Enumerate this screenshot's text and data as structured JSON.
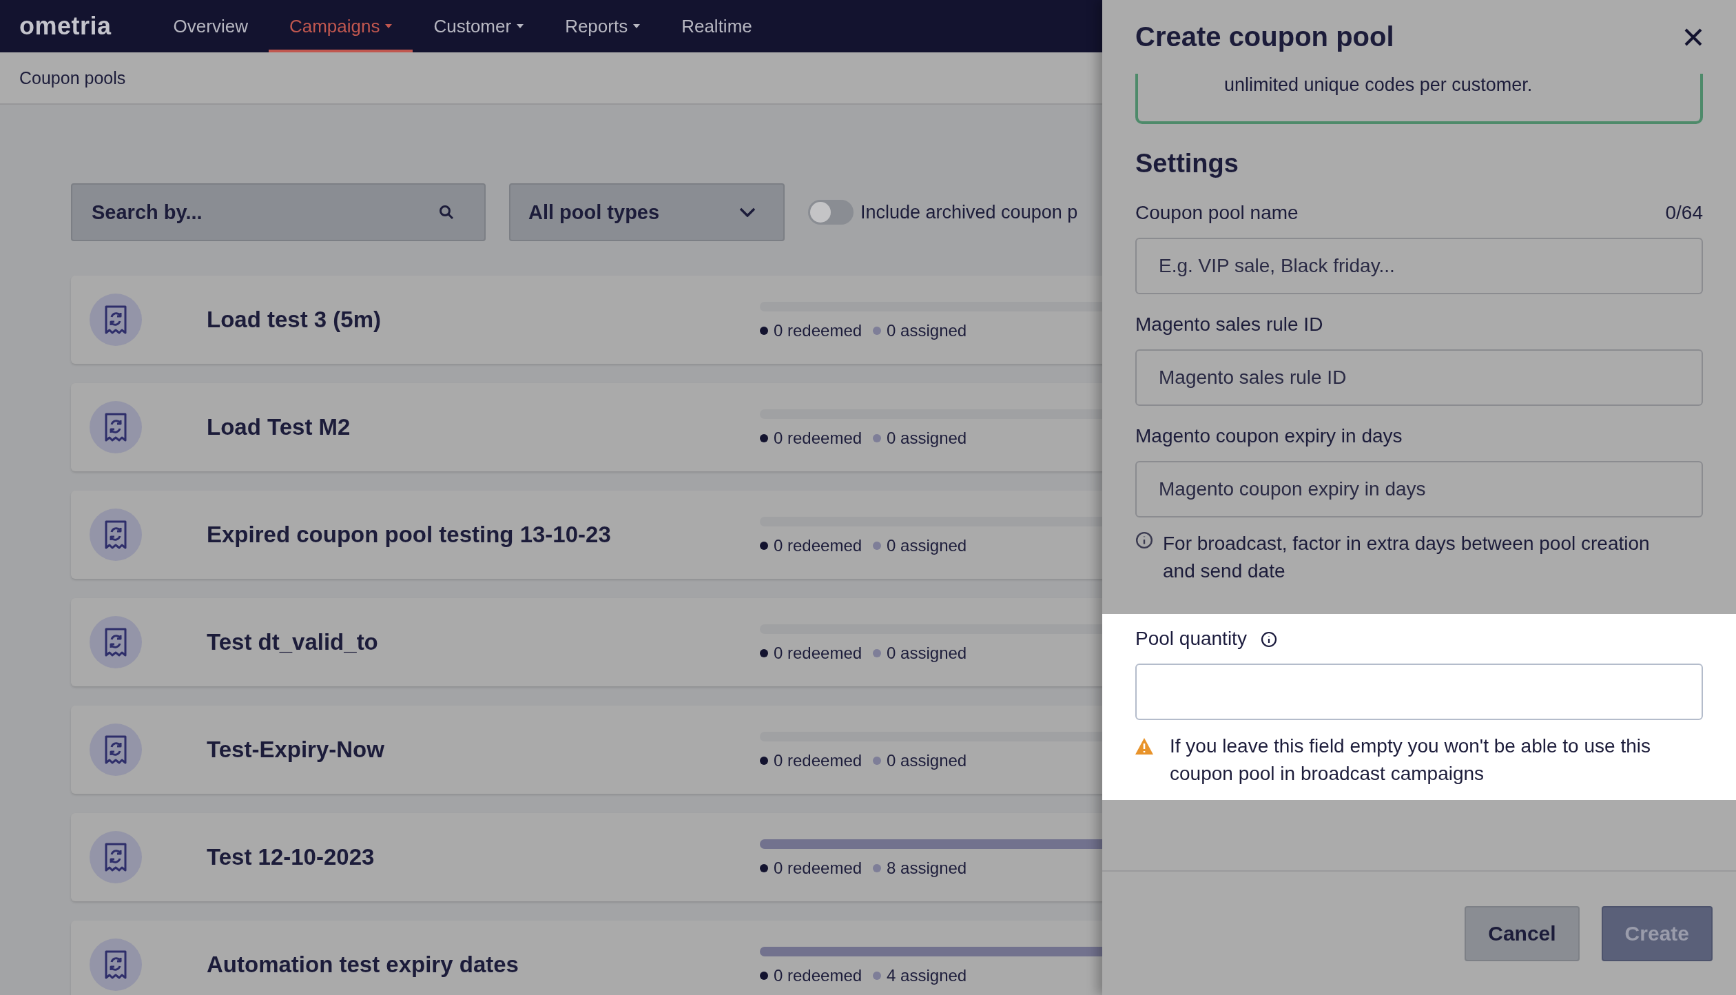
{
  "nav": {
    "logo": "ometria",
    "items": [
      {
        "label": "Overview",
        "selected": false,
        "dropdown": false
      },
      {
        "label": "Campaigns",
        "selected": true,
        "dropdown": true
      },
      {
        "label": "Customer",
        "selected": false,
        "dropdown": true
      },
      {
        "label": "Reports",
        "selected": false,
        "dropdown": true
      },
      {
        "label": "Realtime",
        "selected": false,
        "dropdown": false
      }
    ]
  },
  "breadcrumb": "Coupon pools",
  "filters": {
    "search": {
      "placeholder": "Search by..."
    },
    "pool_type": {
      "value": "All pool types"
    },
    "archived_toggle": {
      "label": "Include archived coupon p",
      "on": false
    }
  },
  "pools": [
    {
      "name": "Load test 3 (5m)",
      "level": 0,
      "redeemed": "0 redeemed",
      "assigned": "0 assigned"
    },
    {
      "name": "Load Test M2",
      "level": 0,
      "redeemed": "0 redeemed",
      "assigned": "0 assigned"
    },
    {
      "name": "Expired coupon pool testing 13-10-23",
      "level": 0,
      "redeemed": "0 redeemed",
      "assigned": "0 assigned"
    },
    {
      "name": "Test dt_valid_to",
      "level": 0,
      "redeemed": "0 redeemed",
      "assigned": "0 assigned"
    },
    {
      "name": "Test-Expiry-Now",
      "level": 0,
      "redeemed": "0 redeemed",
      "assigned": "0 assigned"
    },
    {
      "name": "Test 12-10-2023",
      "level": 1,
      "redeemed": "0 redeemed",
      "assigned": "8 assigned"
    },
    {
      "name": "Automation test expiry dates",
      "level": 1,
      "redeemed": "0 redeemed",
      "assigned": "4 assigned"
    }
  ],
  "panel": {
    "title": "Create coupon pool",
    "notice": "unlimited unique codes per customer.",
    "settings_heading": "Settings",
    "fields": [
      {
        "label": "Coupon pool name",
        "counter": "0/64",
        "placeholder": "E.g. VIP sale, Black friday...",
        "highlighted": false
      },
      {
        "label": "Magento sales rule ID",
        "placeholder": "Magento sales rule ID",
        "highlighted": false
      },
      {
        "label": "Magento coupon expiry in days",
        "placeholder": "Magento coupon expiry in days",
        "highlighted": false,
        "note": {
          "kind": "info",
          "text": "For broadcast, factor in extra days between pool creation and send date"
        }
      },
      {
        "label": "Pool quantity",
        "info": true,
        "highlighted": true,
        "note": {
          "kind": "warning",
          "text": "If you leave this field empty you won't be able to use this coupon pool in broadcast campaigns"
        }
      }
    ],
    "buttons": [
      {
        "label": "Cancel",
        "kind": "secondary",
        "disabled": false
      },
      {
        "label": "Create",
        "kind": "primary",
        "disabled": true
      }
    ]
  }
}
